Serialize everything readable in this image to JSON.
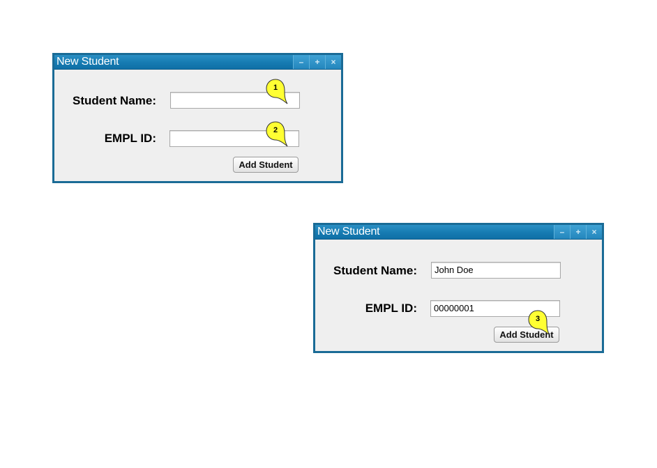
{
  "windows": [
    {
      "title": "New Student",
      "controls": [
        "–",
        "+",
        "×"
      ],
      "student_name_label": "Student Name:",
      "empl_id_label": "EMPL ID:",
      "student_name_value": "",
      "empl_id_value": "",
      "button_label": "Add Student"
    },
    {
      "title": "New Student",
      "controls": [
        "–",
        "+",
        "×"
      ],
      "student_name_label": "Student Name:",
      "empl_id_label": "EMPL ID:",
      "student_name_value": "John Doe",
      "empl_id_value": "00000001",
      "button_label": "Add Student"
    }
  ],
  "callouts": [
    "1",
    "2",
    "3"
  ],
  "colors": {
    "window_border": "#1a6b96",
    "titlebar": "#167bb2",
    "window_body": "#efefef",
    "callout_fill": "#ffff33"
  }
}
